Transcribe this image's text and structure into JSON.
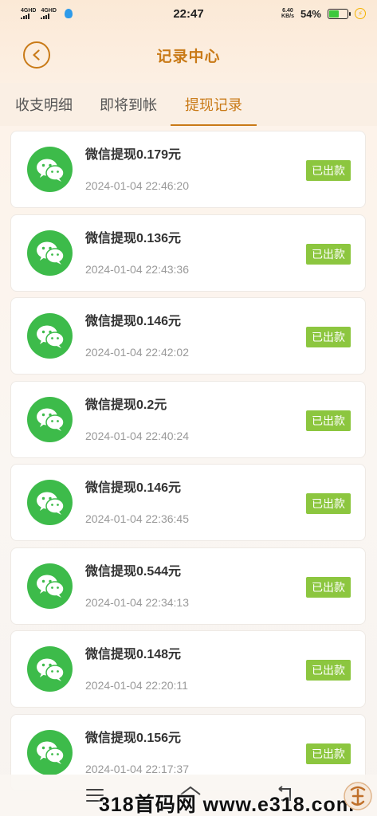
{
  "status_bar": {
    "sim1": "4GHD",
    "sim2": "4GHD",
    "time": "22:47",
    "speed_top": "6.40",
    "speed_bottom": "KB/s",
    "battery": "54%",
    "battery_level": 0.54
  },
  "header": {
    "title": "记录中心"
  },
  "tabs": [
    {
      "label": "收支明细",
      "active": false
    },
    {
      "label": "即将到帐",
      "active": false
    },
    {
      "label": "提现记录",
      "active": true
    }
  ],
  "records": [
    {
      "title": "微信提现0.179元",
      "time": "2024-01-04 22:46:20",
      "status": "已出款"
    },
    {
      "title": "微信提现0.136元",
      "time": "2024-01-04 22:43:36",
      "status": "已出款"
    },
    {
      "title": "微信提现0.146元",
      "time": "2024-01-04 22:42:02",
      "status": "已出款"
    },
    {
      "title": "微信提现0.2元",
      "time": "2024-01-04 22:40:24",
      "status": "已出款"
    },
    {
      "title": "微信提现0.146元",
      "time": "2024-01-04 22:36:45",
      "status": "已出款"
    },
    {
      "title": "微信提现0.544元",
      "time": "2024-01-04 22:34:13",
      "status": "已出款"
    },
    {
      "title": "微信提现0.148元",
      "time": "2024-01-04 22:20:11",
      "status": "已出款"
    },
    {
      "title": "微信提现0.156元",
      "time": "2024-01-04 22:17:37",
      "status": "已出款"
    }
  ],
  "icons": {
    "back": "chevron-left-icon",
    "record": "wechat-icon"
  },
  "colors": {
    "accent": "#c97a17",
    "wechat_green": "#3dbb4a",
    "badge_green": "#8cc63f"
  },
  "watermark": "318首码网 www.e318.com"
}
